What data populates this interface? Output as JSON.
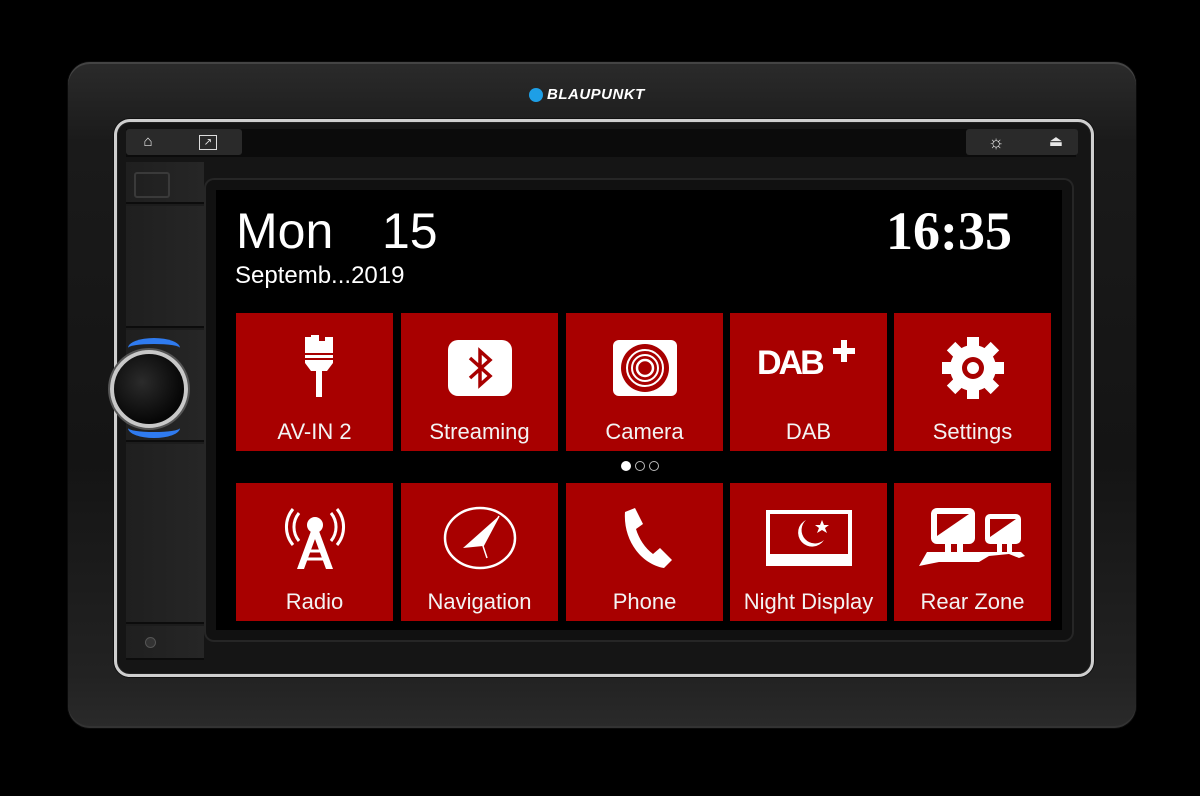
{
  "brand": {
    "name": "BLAUPUNKT",
    "dot_color": "#1e9fe6"
  },
  "hardware_buttons": {
    "left": [
      {
        "icon": "home-icon",
        "glyph": "⌂"
      },
      {
        "icon": "exit-app-icon",
        "glyph": "⬈"
      }
    ],
    "right": [
      {
        "icon": "brightness-icon",
        "glyph": "☼"
      },
      {
        "icon": "eject-icon",
        "glyph": "⏏"
      }
    ]
  },
  "status": {
    "day": "Mon",
    "date": "15",
    "month_year": "Septemb...2019",
    "time": "16:35"
  },
  "tiles": [
    {
      "label": "AV-IN 2",
      "icon": "av-input-plug-icon"
    },
    {
      "label": "Streaming",
      "icon": "bluetooth-icon"
    },
    {
      "label": "Camera",
      "icon": "camera-icon"
    },
    {
      "label": "DAB",
      "icon": "dab-plus-icon"
    },
    {
      "label": "Settings",
      "icon": "gear-icon"
    },
    {
      "label": "Radio",
      "icon": "radio-tower-icon"
    },
    {
      "label": "Navigation",
      "icon": "navigation-compass-icon"
    },
    {
      "label": "Phone",
      "icon": "phone-icon"
    },
    {
      "label": "Night Display",
      "icon": "night-moon-icon"
    },
    {
      "label": "Rear Zone",
      "icon": "rear-zone-monitors-icon"
    }
  ],
  "pager": {
    "pages": 3,
    "current": 1
  },
  "colors": {
    "tile_bg": "#a80000",
    "knob_ring": "#2f7bf0"
  }
}
